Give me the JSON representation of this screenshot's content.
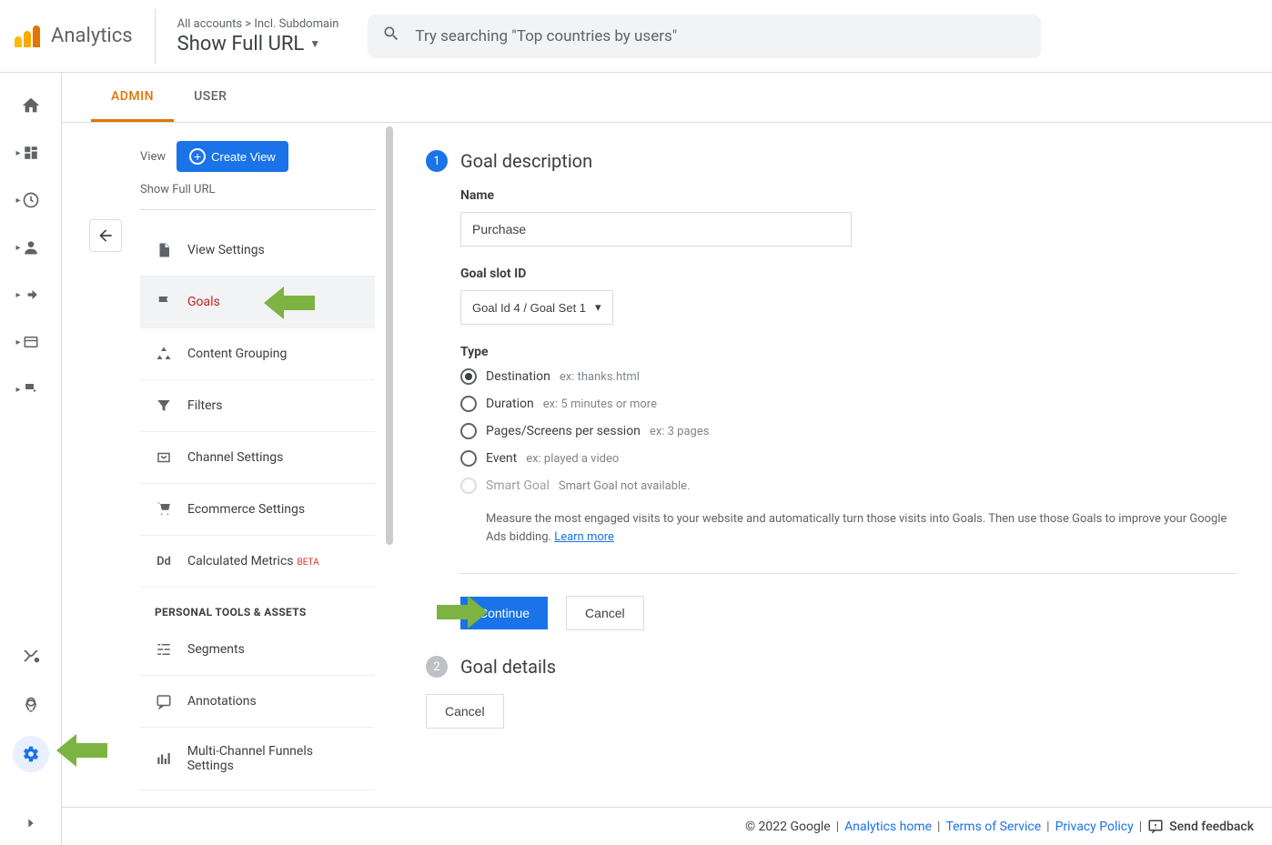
{
  "header": {
    "product": "Analytics",
    "breadcrumb": "All accounts > Incl. Subdomain",
    "title": "Show Full URL",
    "search_placeholder": "Try searching \"Top countries by users\""
  },
  "tabs": {
    "admin": "ADMIN",
    "user": "USER"
  },
  "admin_sidebar": {
    "view_label": "View",
    "create_view": "Create View",
    "view_name": "Show Full URL",
    "items": [
      {
        "label": "View Settings"
      },
      {
        "label": "Goals"
      },
      {
        "label": "Content Grouping"
      },
      {
        "label": "Filters"
      },
      {
        "label": "Channel Settings"
      },
      {
        "label": "Ecommerce Settings"
      },
      {
        "label": "Calculated Metrics",
        "beta": "BETA"
      }
    ],
    "section_header": "PERSONAL TOOLS & ASSETS",
    "personal_items": [
      {
        "label": "Segments"
      },
      {
        "label": "Annotations"
      },
      {
        "label": "Multi-Channel Funnels Settings"
      }
    ]
  },
  "form": {
    "step1_title": "Goal description",
    "name_label": "Name",
    "name_value": "Purchase",
    "slot_label": "Goal slot ID",
    "slot_value": "Goal Id 4 / Goal Set 1",
    "type_label": "Type",
    "types": [
      {
        "label": "Destination",
        "hint": "ex: thanks.html",
        "checked": true
      },
      {
        "label": "Duration",
        "hint": "ex: 5 minutes or more"
      },
      {
        "label": "Pages/Screens per session",
        "hint": "ex: 3 pages"
      },
      {
        "label": "Event",
        "hint": "ex: played a video"
      },
      {
        "label": "Smart Goal",
        "hint": "Smart Goal not available.",
        "disabled": true
      }
    ],
    "smart_desc": "Measure the most engaged visits to your website and automatically turn those visits into Goals. Then use those Goals to improve your Google Ads bidding.",
    "learn_more": "Learn more",
    "continue": "Continue",
    "cancel": "Cancel",
    "step2_title": "Goal details"
  },
  "footer": {
    "copyright": "© 2022 Google",
    "home": "Analytics home",
    "terms": "Terms of Service",
    "privacy": "Privacy Policy",
    "feedback": "Send feedback"
  }
}
